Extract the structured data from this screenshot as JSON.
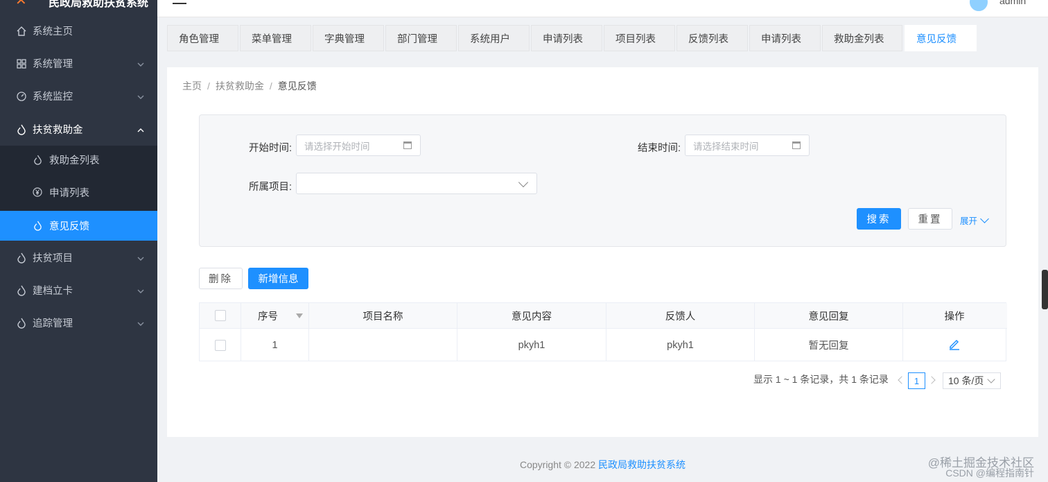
{
  "app": {
    "title": "民政局救助扶贫系统"
  },
  "user": {
    "name": "admin"
  },
  "sidebar": {
    "items": [
      {
        "label": "系统主页"
      },
      {
        "label": "系统管理"
      },
      {
        "label": "系统监控"
      },
      {
        "label": "扶贫救助金"
      },
      {
        "label": "扶贫项目"
      },
      {
        "label": "建档立卡"
      },
      {
        "label": "追踪管理"
      }
    ],
    "sub_items": [
      {
        "label": "救助金列表"
      },
      {
        "label": "申请列表"
      },
      {
        "label": "意见反馈"
      }
    ]
  },
  "tabs": [
    {
      "label": "角色管理"
    },
    {
      "label": "菜单管理"
    },
    {
      "label": "字典管理"
    },
    {
      "label": "部门管理"
    },
    {
      "label": "系统用户"
    },
    {
      "label": "申请列表"
    },
    {
      "label": "项目列表"
    },
    {
      "label": "反馈列表"
    },
    {
      "label": "申请列表"
    },
    {
      "label": "救助金列表"
    },
    {
      "label": "意见反馈"
    }
  ],
  "breadcrumb": [
    "主页",
    "扶贫救助金",
    "意见反馈"
  ],
  "filters": {
    "start_label": "开始时间:",
    "start_placeholder": "请选择开始时间",
    "end_label": "结束时间:",
    "end_placeholder": "请选择结束时间",
    "project_label": "所属项目:",
    "project_value": "",
    "search_btn": "搜索",
    "reset_btn": "重置",
    "expand": "展开"
  },
  "actions": {
    "delete": "删除",
    "add": "新增信息"
  },
  "table": {
    "columns": [
      "序号",
      "项目名称",
      "意见内容",
      "反馈人",
      "意见回复",
      "操作"
    ],
    "rows": [
      {
        "index": "1",
        "project": "",
        "content": "pkyh1",
        "person": "pkyh1",
        "reply": "暂无回复"
      }
    ]
  },
  "pagination": {
    "summary": "显示 1 ~ 1 条记录，共 1 条记录",
    "current_page": "1",
    "page_size": "10 条/页"
  },
  "footer": {
    "copyright": "Copyright © 2022",
    "brand": "民政局救助扶贫系统"
  },
  "watermark": {
    "line1": "@稀土掘金技术社区",
    "line2": "CSDN @编程指南针"
  }
}
